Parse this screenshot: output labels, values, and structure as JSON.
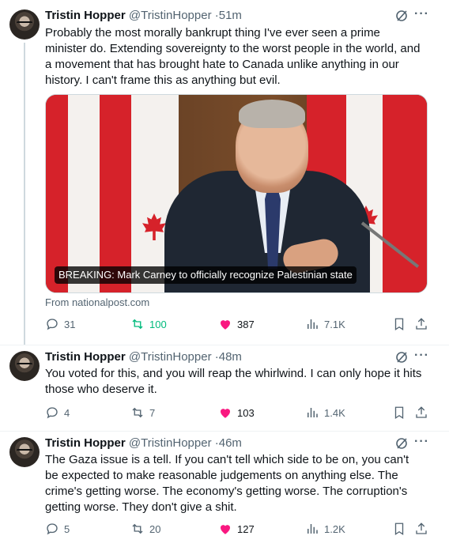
{
  "author": {
    "name": "Tristin Hopper",
    "handle": "@TristinHopper"
  },
  "tweets": [
    {
      "time": "51m",
      "text": "Probably the most morally bankrupt thing I've ever seen a prime minister do. Extending sovereignty to the worst people in the world, and a movement that has brought hate to Canada unlike anything in our history. I can't frame this as anything but evil.",
      "card": {
        "caption": "BREAKING: Mark Carney to officially recognize Palestinian state",
        "source": "From nationalpost.com"
      },
      "replies": "31",
      "reposts": "100",
      "likes": "387",
      "views": "7.1K"
    },
    {
      "time": "48m",
      "text": "You voted for this, and you will reap the whirlwind. I can only hope it hits those who deserve it.",
      "replies": "4",
      "reposts": "7",
      "likes": "103",
      "views": "1.4K"
    },
    {
      "time": "46m",
      "text": "The Gaza issue is a tell. If you can't tell which side to be on, you can't be expected to make reasonable judgements on anything else. The crime's getting worse. The economy's getting worse. The corruption's getting worse. They don't give a shit.",
      "replies": "5",
      "reposts": "20",
      "likes": "127",
      "views": "1.2K"
    }
  ],
  "colors": {
    "like": "#f91880",
    "repost_active": "#00ba7c",
    "muted": "#536471",
    "thread_line": "#cfd9de"
  },
  "icons": [
    "reply-icon",
    "repost-icon",
    "heart-filled-icon",
    "views-icon",
    "bookmark-icon",
    "share-icon",
    "grok-icon",
    "more-icon"
  ]
}
